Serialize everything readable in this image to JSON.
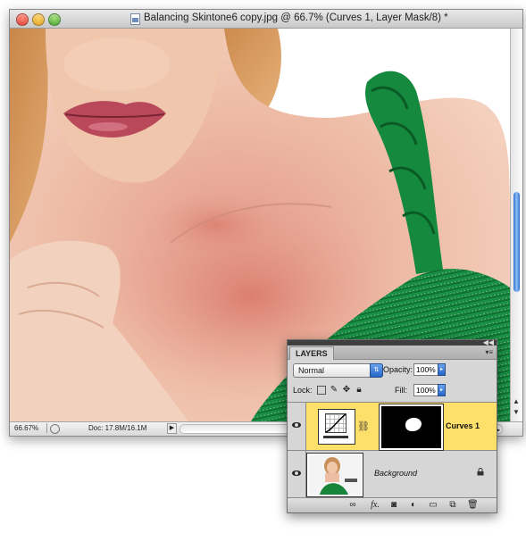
{
  "window": {
    "title": "Balancing Skintone6 copy.jpg @ 66.7% (Curves 1, Layer Mask/8) *",
    "zoom": "66.67%",
    "doc_info": "Doc: 17.8M/16.1M"
  },
  "layers_panel": {
    "tab_label": "LAYERS",
    "blend_mode": "Normal",
    "opacity_label": "Opacity:",
    "opacity_value": "100%",
    "lock_label": "Lock:",
    "fill_label": "Fill:",
    "fill_value": "100%",
    "layers": [
      {
        "name": "Curves 1",
        "selected": true
      },
      {
        "name": "Background",
        "selected": false
      }
    ],
    "bottom_icons": [
      "link-icon",
      "fx-icon",
      "mask-icon",
      "adjustment-icon",
      "group-icon",
      "new-layer-icon",
      "trash-icon"
    ],
    "fx_label": "fx."
  },
  "colors": {
    "selected_layer": "#fde06a",
    "scroll_thumb": "#2e6fd0",
    "dress_green": "#14803c",
    "skin": "#e8b8a0"
  }
}
